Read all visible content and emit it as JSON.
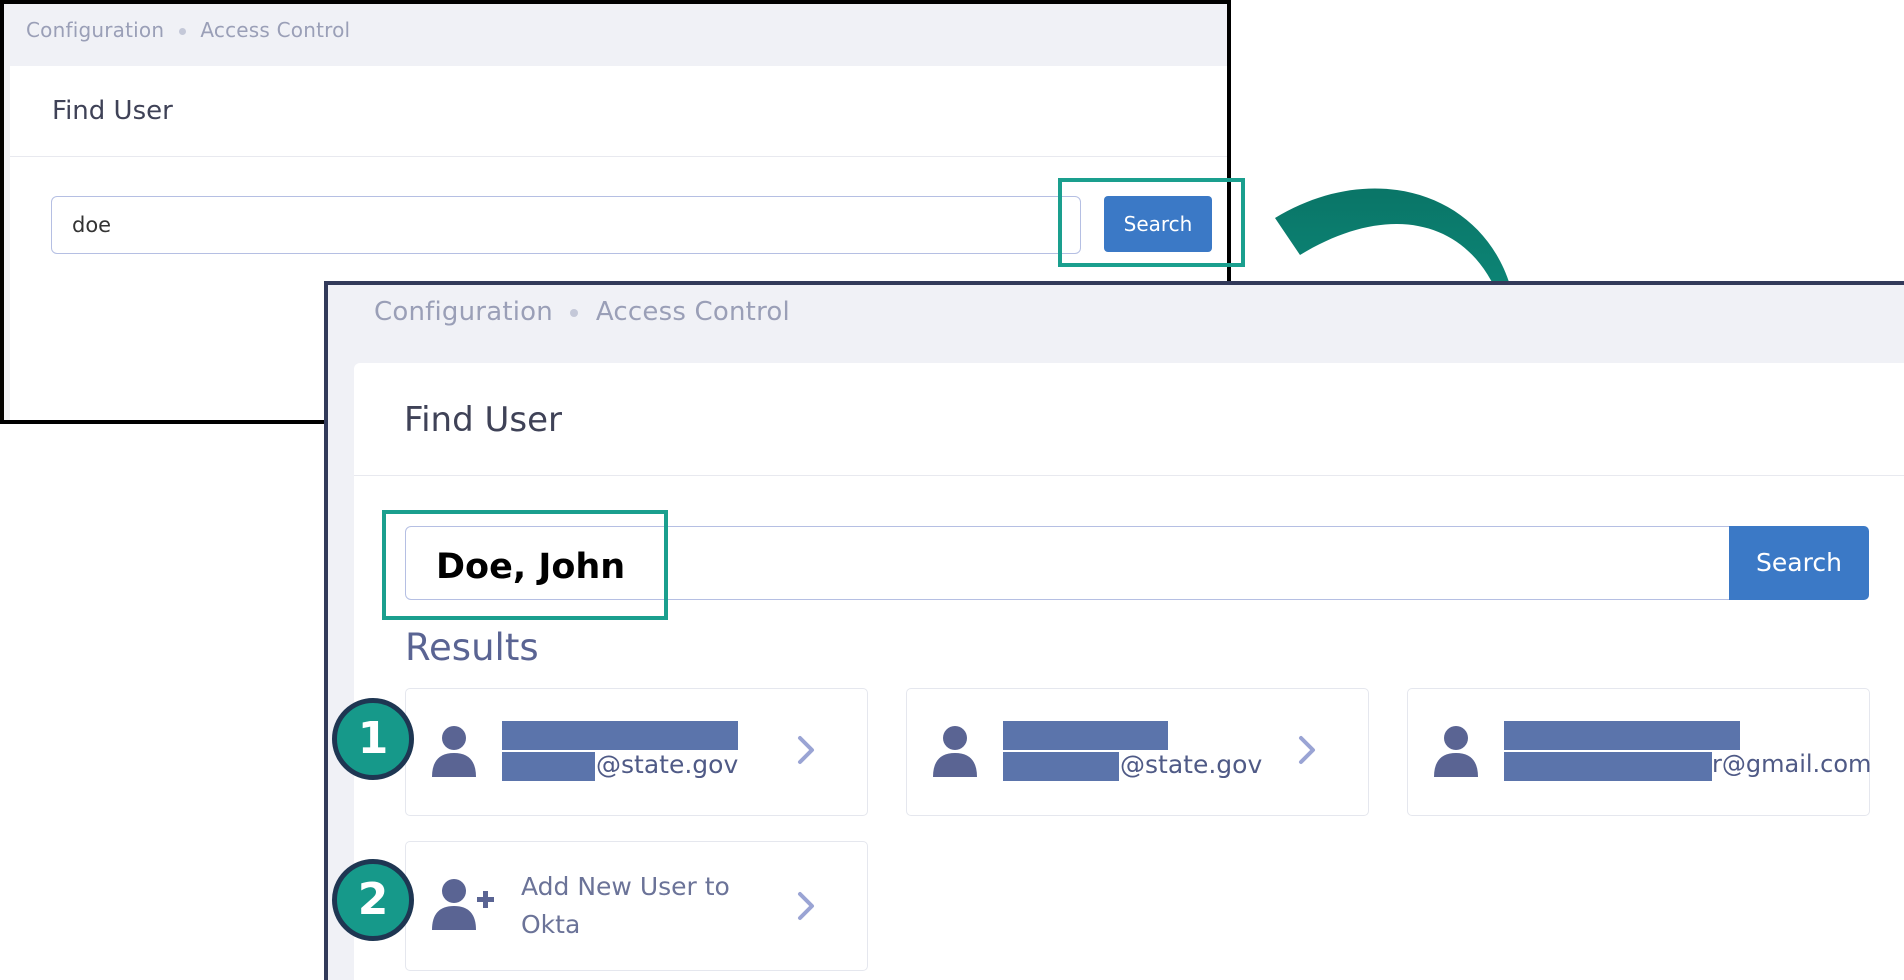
{
  "colors": {
    "accent": "#3b79c6",
    "highlight": "#1a9f8e",
    "arrow": "#0d8a7a",
    "redaction": "#5b74ab",
    "marker_fill": "#16998a",
    "marker_ring": "#1e3652"
  },
  "before": {
    "breadcrumb": [
      "Configuration",
      "Access Control"
    ],
    "title": "Find User",
    "search_value": "doe",
    "search_button": "Search"
  },
  "after": {
    "breadcrumb": [
      "Configuration",
      "Access Control"
    ],
    "title": "Find User",
    "search_value": "Doe, John",
    "search_button": "Search",
    "results_heading": "Results",
    "results": [
      {
        "icon": "user-icon",
        "email_suffix": "@state.gov"
      },
      {
        "icon": "user-icon",
        "email_suffix": "@state.gov"
      },
      {
        "icon": "user-icon",
        "email_suffix": "r@gmail.com"
      }
    ],
    "add_user": {
      "icon": "add-user-icon",
      "label_line1": "Add New User to",
      "label_line2": "Okta"
    }
  },
  "markers": [
    "1",
    "2"
  ]
}
